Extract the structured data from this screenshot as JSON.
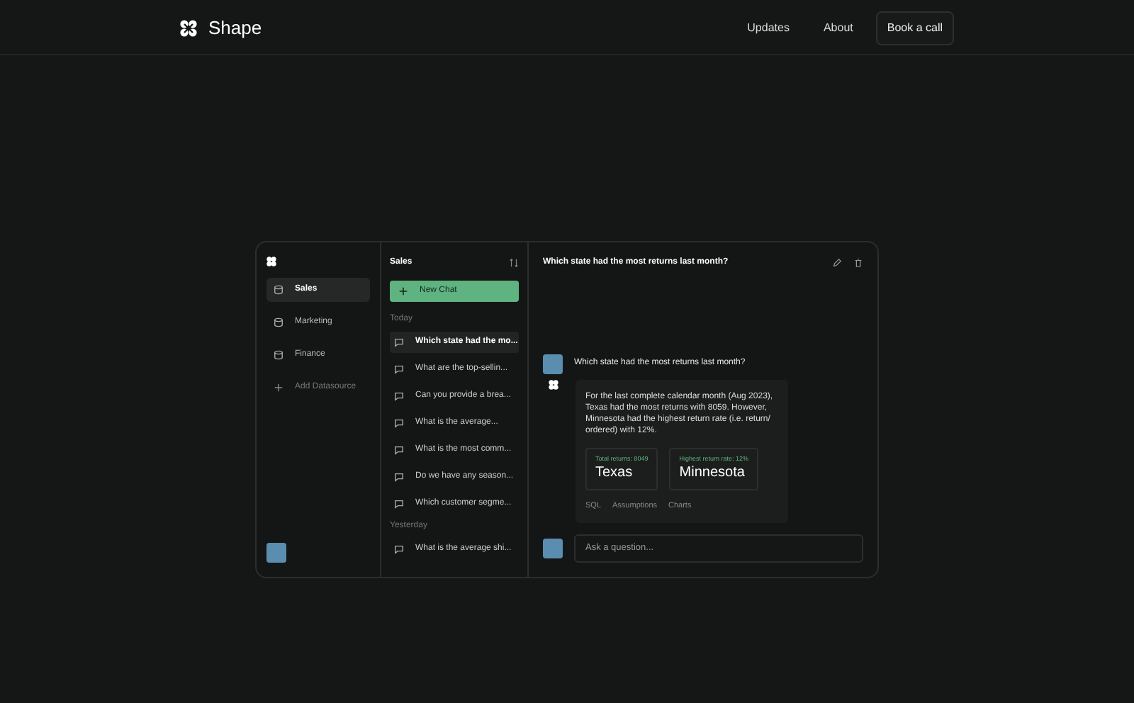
{
  "header": {
    "brand": "Shape",
    "links": [
      {
        "label": "Updates"
      },
      {
        "label": "About"
      }
    ],
    "cta": "Book a call"
  },
  "app": {
    "sidebar": {
      "items": [
        {
          "label": "Sales",
          "selected": true
        },
        {
          "label": "Marketing",
          "selected": false
        },
        {
          "label": "Finance",
          "selected": false
        }
      ],
      "add": "Add Datasource"
    },
    "chats": {
      "title": "Sales",
      "new_chat": "New Chat",
      "groups": [
        {
          "label": "Today",
          "items": [
            {
              "label": "Which state had the mo...",
              "selected": true
            },
            {
              "label": "What are the top-sellin...",
              "selected": false
            },
            {
              "label": "Can you provide a brea...",
              "selected": false
            },
            {
              "label": "What is the average...",
              "selected": false
            },
            {
              "label": "What is the most comm...",
              "selected": false
            },
            {
              "label": "Do we have any season...",
              "selected": false
            },
            {
              "label": "Which customer segme...",
              "selected": false
            }
          ]
        },
        {
          "label": "Yesterday",
          "items": [
            {
              "label": "What is the average shi...",
              "selected": false
            }
          ]
        }
      ]
    },
    "conversation": {
      "title": "Which state had the most returns last month?",
      "question": "Which state had the most returns last month?",
      "answer": "For the last complete calendar month (Aug 2023), Texas had the most returns with 8059. However, Minnesota had the highest return rate (i.e. return/ ordered) with 12%.",
      "stats": [
        {
          "label": "Total returns: 8049",
          "value": "Texas"
        },
        {
          "label": "Highest return rate: 12%",
          "value": "Minnesota"
        }
      ],
      "tabs": [
        "SQL",
        "Assumptions",
        "Charts"
      ],
      "input": {
        "placeholder": "Ask a question..."
      }
    }
  }
}
